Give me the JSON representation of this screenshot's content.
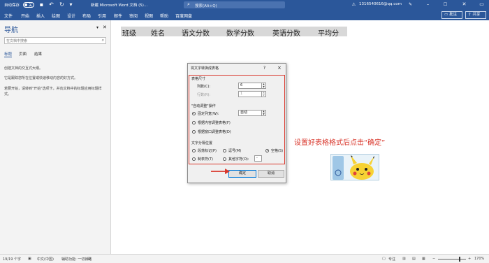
{
  "titlebar": {
    "autosave": "自动保存",
    "toggle": "关",
    "doc_title": "新建 Microsoft Word 文档 (5)...",
    "search_placeholder": "搜索(Alt+Q)",
    "account": "1316540616@qq.com"
  },
  "menu": {
    "items": [
      "文件",
      "开始",
      "插入",
      "绘图",
      "设计",
      "布局",
      "引用",
      "邮件",
      "审阅",
      "视图",
      "帮助",
      "百度网盘"
    ],
    "comment_btn": "批注",
    "share_btn": "共享"
  },
  "nav": {
    "title": "导航",
    "search_placeholder": "在文档中搜索",
    "tabs": [
      "标题",
      "页面",
      "结果"
    ],
    "paragraphs": [
      "创建文档的交互式大纲。",
      "它是跟踪您所在位置或快速移动内容的好方式。",
      "若要开始，请转到\"开始\"选项卡，并向文档中的标题应用标题样式。"
    ]
  },
  "table_header": [
    "班级",
    "姓名",
    "语文分数",
    "数学分数",
    "英语分数",
    "平均分"
  ],
  "dialog": {
    "title": "将文字转换成表格",
    "help": "?",
    "close": "×",
    "size_group": "表格尺寸",
    "cols_label": "列数(C):",
    "cols_value": "6",
    "rows_label": "行数(R):",
    "rows_value": "1",
    "autofit_group": "\"自动调整\"操作",
    "fixed_label": "固定列宽(W):",
    "fixed_value": "自动",
    "fit_content": "根据内容调整表格(F)",
    "fit_window": "根据窗口调整表格(D)",
    "sep_group": "文字分隔位置",
    "sep_para": "段落标记(P)",
    "sep_comma": "逗号(M)",
    "sep_space": "空格(S)",
    "sep_tab": "制表符(T)",
    "sep_other": "其他字符(O):",
    "other_value": "-",
    "ok": "确定",
    "cancel": "取消"
  },
  "annotation": "设置好表格格式后点击“确定”",
  "status": {
    "page": "19/19 个字",
    "lang": "中文(中国)",
    "access": "辅助功能: 一切就绪",
    "focus": "专注",
    "zoom": "170%"
  },
  "colors": {
    "accent": "#2b579a",
    "annotation": "#d9372c"
  }
}
